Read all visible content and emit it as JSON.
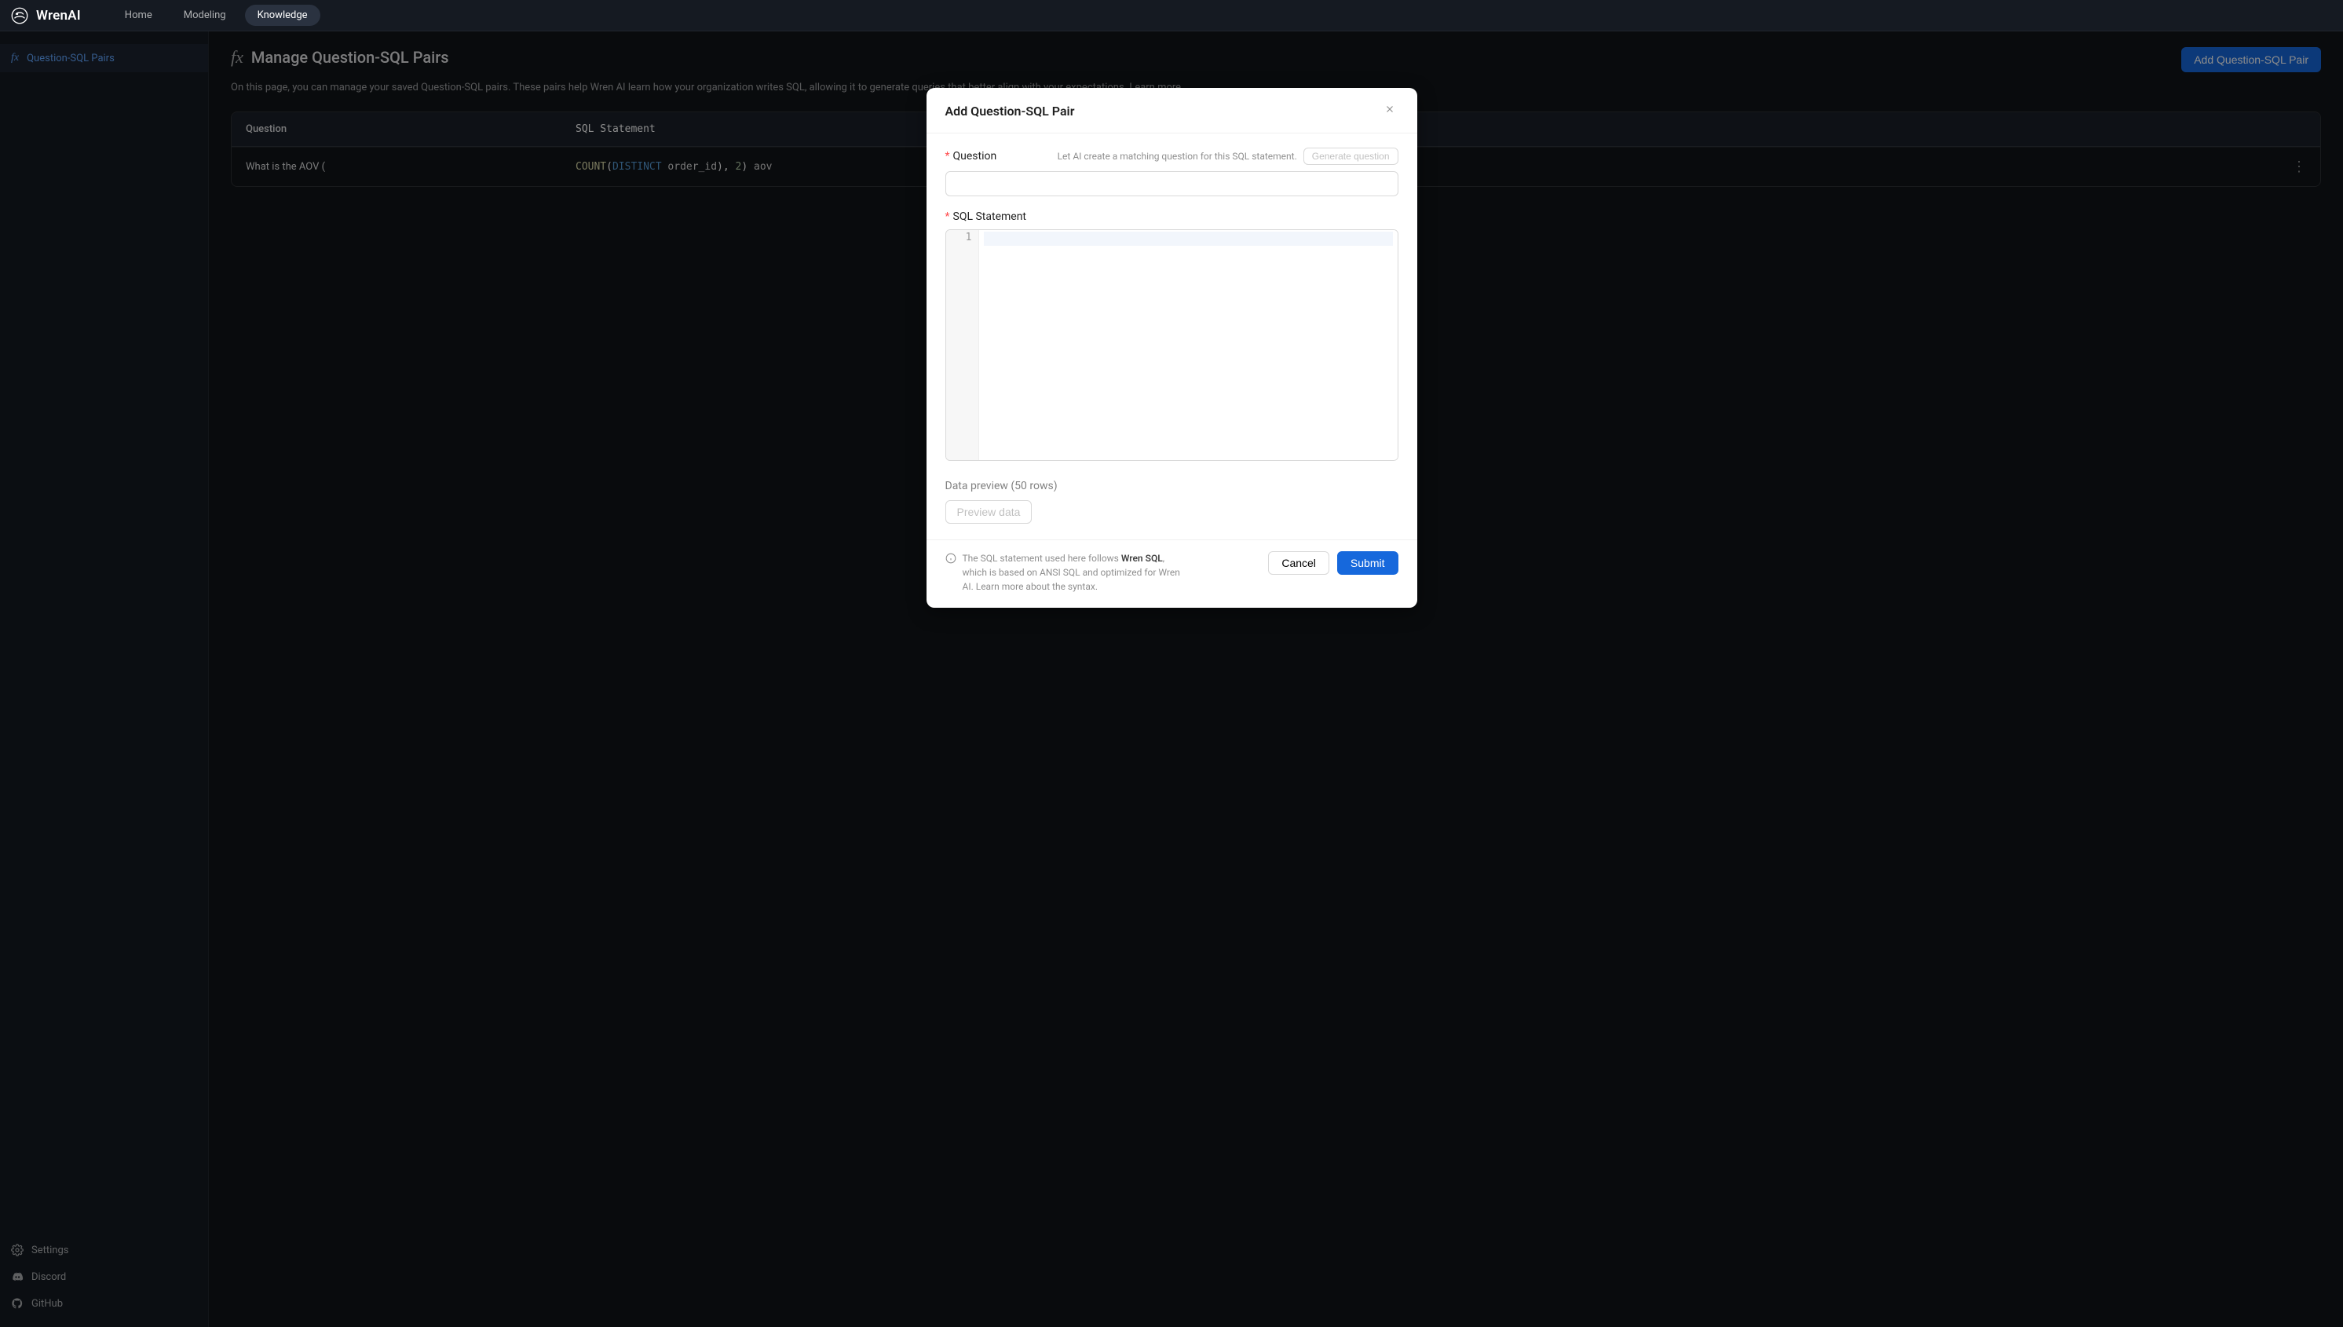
{
  "brand": {
    "name": "WrenAI"
  },
  "nav": {
    "home": "Home",
    "modeling": "Modeling",
    "knowledge": "Knowledge"
  },
  "sidebar": {
    "main": {
      "label": "Question-SQL Pairs"
    },
    "settings": "Settings",
    "discord": "Discord",
    "github": "GitHub"
  },
  "page": {
    "title": "Manage Question-SQL Pairs",
    "add_btn": "Add Question-SQL Pair",
    "desc_1": "On this page, you can manage your saved Question-SQL pairs. These pairs help Wren AI learn how your organization writes SQL, allowing it to generate queries that better align with your expectations. ",
    "learn_more": "Learn more",
    "col_question": "Question",
    "col_sql": "SQL Statement",
    "row": {
      "question": "What is the AOV (",
      "sql_prefix": "COUNT",
      "sql_paren1": "(",
      "sql_distinct": "DISTINCT",
      "sql_col": " order_id",
      "sql_paren2": ")",
      "sql_comma": ", ",
      "sql_num": "2",
      "sql_paren3": ")",
      "sql_alias": " aov"
    }
  },
  "modal": {
    "title": "Add Question-SQL Pair",
    "question_label": "Question",
    "question_hint": "Let AI create a matching question for this SQL statement.",
    "generate_btn": "Generate question",
    "sql_label": "SQL Statement",
    "line_no": "1",
    "preview_label": "Data preview (50 rows)",
    "preview_btn": "Preview data",
    "foot_note_1": "The SQL statement used here follows ",
    "foot_note_bold": "Wren SQL",
    "foot_note_2": ", which is based on ANSI SQL and optimized for Wren AI. Learn more about the syntax.",
    "cancel": "Cancel",
    "submit": "Submit"
  }
}
